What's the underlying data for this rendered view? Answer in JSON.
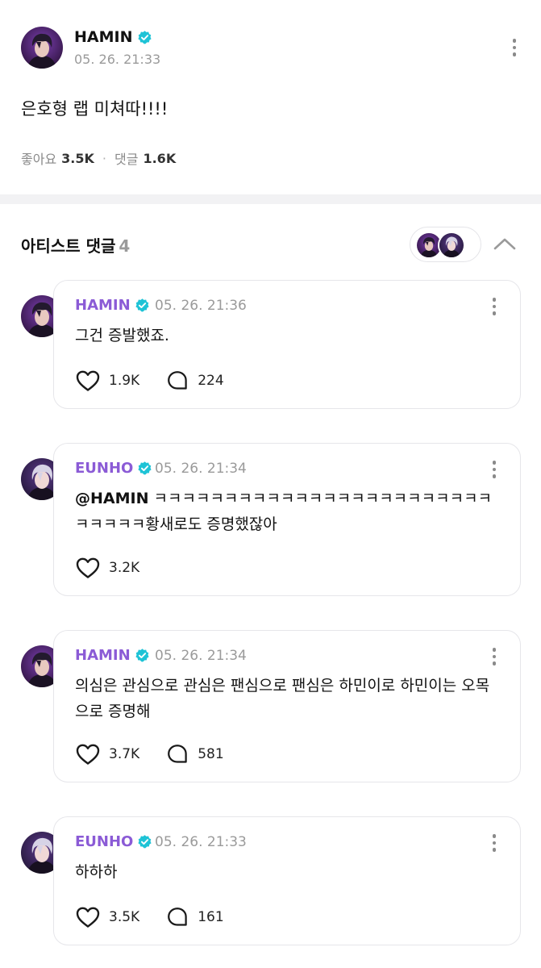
{
  "colors": {
    "accent_name": "#8b5bd6",
    "verified": "#1ec3d6",
    "muted": "#9a9a9a"
  },
  "post": {
    "author": "HAMIN",
    "time": "05. 26. 21:33",
    "text": "은호형 랩 미쳐따!!!!",
    "likes_label": "좋아요",
    "likes_value": "3.5K",
    "separator": "·",
    "comments_label": "댓글",
    "comments_value": "1.6K"
  },
  "section": {
    "title": "아티스트 댓글",
    "count": "4"
  },
  "icons": {
    "verified": "verified-check-icon",
    "more": "kebab-icon",
    "like": "heart-icon",
    "reply": "speech-bubble-icon",
    "collapse": "chevron-up-icon"
  },
  "comments": [
    {
      "author": "HAMIN",
      "time": "05. 26. 21:36",
      "mention": "",
      "text": "그건 증발했죠.",
      "likes": "1.9K",
      "replies": "224"
    },
    {
      "author": "EUNHO",
      "time": "05. 26. 21:34",
      "mention": "@HAMIN",
      "text": " ㅋㅋㅋㅋㅋㅋㅋㅋㅋㅋㅋㅋㅋㅋㅋㅋㅋㅋㅋㅋㅋㅋㅋㅋㅋㅋㅋㅋㅋ황새로도 증명했잖아",
      "likes": "3.2K",
      "replies": ""
    },
    {
      "author": "HAMIN",
      "time": "05. 26. 21:34",
      "mention": "",
      "text": "의심은 관심으로 관심은 팬심으로 팬심은 하민이로 하민이는 오목으로 증명해",
      "likes": "3.7K",
      "replies": "581"
    },
    {
      "author": "EUNHO",
      "time": "05. 26. 21:33",
      "mention": "",
      "text": "하하하",
      "likes": "3.5K",
      "replies": "161"
    }
  ]
}
